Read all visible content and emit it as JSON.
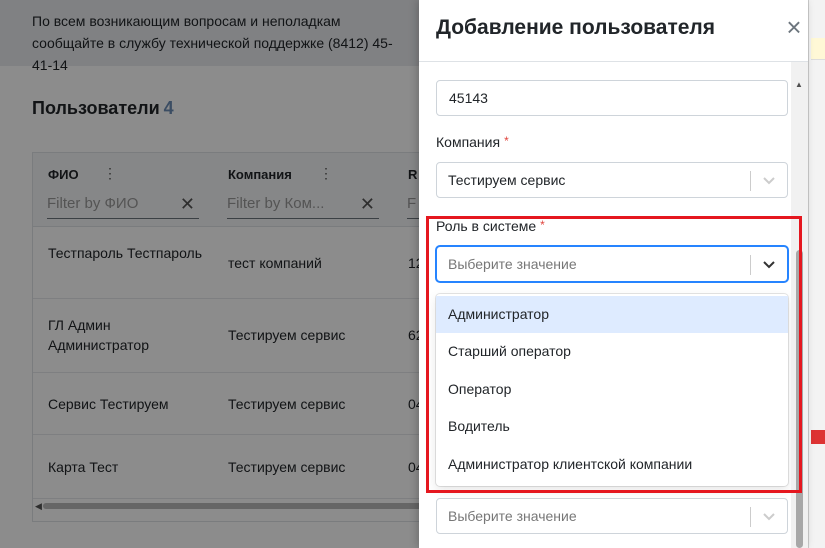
{
  "background": {
    "banner_text": "По всем возникающим вопросам и неполадкам сообщайте в службу технической поддержке (8412) 45-41-14",
    "page_title": "Пользователи",
    "user_count": "4",
    "grid": {
      "columns": [
        {
          "title": "ФИО",
          "filter_placeholder": "Filter by ФИО"
        },
        {
          "title": "Компания",
          "filter_placeholder": "Filter by Ком..."
        },
        {
          "title": "R",
          "filter_placeholder": "F"
        }
      ],
      "rows": [
        {
          "fio": "Тестпароль Тестпароль",
          "company": "тест компаний",
          "extra": "12"
        },
        {
          "fio": "ГЛ Админ Администратор",
          "company": "Тестируем сервис",
          "extra": "62"
        },
        {
          "fio": "Сервис Тестируем",
          "company": "Тестируем сервис",
          "extra": "04"
        },
        {
          "fio": "Карта Тест",
          "company": "Тестируем сервис",
          "extra": "04"
        }
      ]
    }
  },
  "modal": {
    "title": "Добавление пользователя",
    "close_label": "×",
    "code_value": "45143",
    "company_label": "Компания",
    "company_value": "Тестируем сервис",
    "role_label": "Роль в системе",
    "required_mark": "*",
    "role_placeholder": "Выберите значение",
    "role_options": [
      "Администратор",
      "Старший оператор",
      "Оператор",
      "Водитель",
      "Администратор клиентской компании"
    ],
    "next_placeholder": "Выберите значение"
  },
  "colors": {
    "highlight": "#e5171f",
    "focus": "#2684ff",
    "option_active": "#deebff",
    "required": "#e0443d"
  }
}
